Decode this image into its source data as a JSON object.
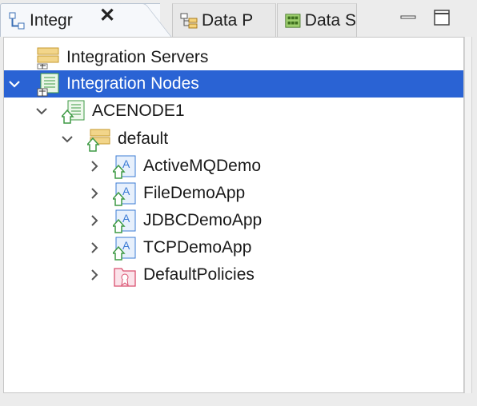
{
  "tabs": [
    {
      "label": "Integr",
      "icon": "integration-explorer-icon",
      "active": true
    },
    {
      "label": "Data P",
      "icon": "data-project-icon",
      "active": false
    },
    {
      "label": "Data S",
      "icon": "data-source-icon",
      "active": false
    }
  ],
  "tree": {
    "integration_servers": "Integration Servers",
    "integration_nodes": "Integration Nodes",
    "node": "ACENODE1",
    "server": "default",
    "apps": [
      "ActiveMQDemo",
      "FileDemoApp",
      "JDBCDemoApp",
      "TCPDemoApp"
    ],
    "policies": "DefaultPolicies"
  },
  "colors": {
    "selection": "#2a63d4",
    "server_icon": "#e8c26a",
    "node_icon": "#3e9a45",
    "app_icon": "#3b7bd4",
    "policy_icon": "#d9506f"
  }
}
